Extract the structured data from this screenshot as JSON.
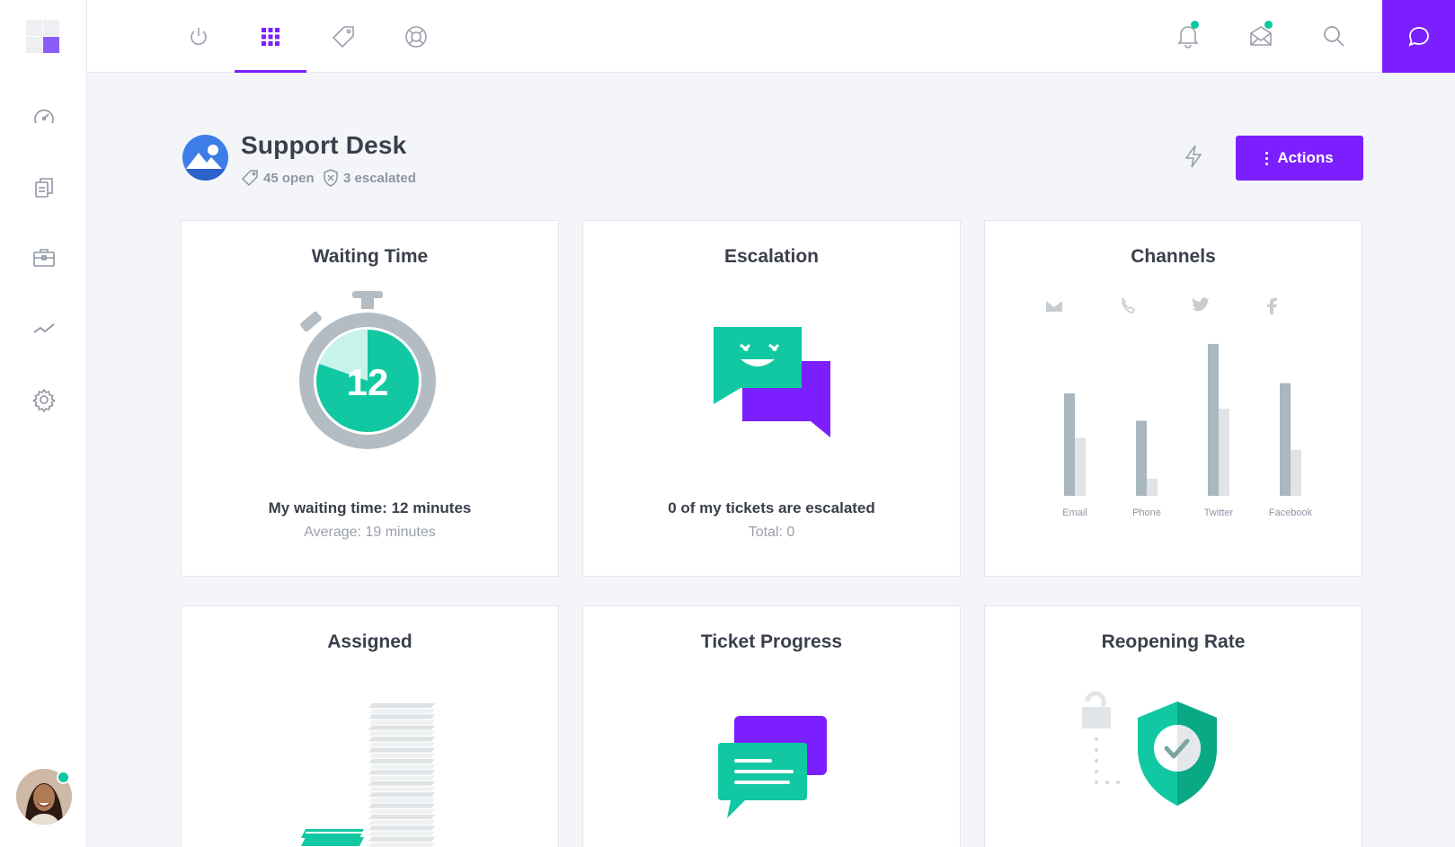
{
  "sidebar": {
    "items": [
      {
        "name": "dashboard",
        "icon": "speedometer-icon"
      },
      {
        "name": "documents",
        "icon": "documents-icon"
      },
      {
        "name": "briefcase",
        "icon": "briefcase-icon"
      },
      {
        "name": "analytics",
        "icon": "trend-line-icon"
      },
      {
        "name": "settings",
        "icon": "gear-icon"
      }
    ],
    "status_color": "#0bc8a0"
  },
  "topbar": {
    "tabs": [
      {
        "icon": "power-icon",
        "active": false
      },
      {
        "icon": "grid-icon",
        "active": true
      },
      {
        "icon": "tag-icon",
        "active": false
      },
      {
        "icon": "lifebuoy-icon",
        "active": false
      }
    ],
    "right_icons": [
      "bell-icon",
      "mail-icon",
      "search-icon",
      "chat-bubble-icon"
    ],
    "accent": "#7c1fff"
  },
  "header": {
    "title": "Support Desk",
    "open_label": "45 open",
    "escalated_label": "3 escalated",
    "actions_label": "Actions"
  },
  "cards": {
    "waiting": {
      "title": "Waiting Time",
      "value": "12",
      "line1": "My waiting time: 12 minutes",
      "line2": "Average: 19 minutes"
    },
    "escalation": {
      "title": "Escalation",
      "line1": "0 of my tickets are escalated",
      "line2": "Total: 0"
    },
    "channels": {
      "title": "Channels"
    },
    "assigned": {
      "title": "Assigned"
    },
    "progress": {
      "title": "Ticket Progress"
    },
    "reopening": {
      "title": "Reopening Rate"
    }
  },
  "chart_data": {
    "type": "bar",
    "categories": [
      "Email",
      "Phone",
      "Twitter",
      "Facebook"
    ],
    "category_icons": [
      "envelope-icon",
      "phone-icon",
      "twitter-icon",
      "facebook-icon"
    ],
    "series": [
      {
        "values": [
          60,
          44,
          89,
          66
        ],
        "color": "#a9b7bf"
      },
      {
        "values": [
          34,
          10,
          51,
          27
        ],
        "color": "#dfe4e7"
      }
    ],
    "ylim": [
      0,
      100
    ],
    "grid": false
  }
}
